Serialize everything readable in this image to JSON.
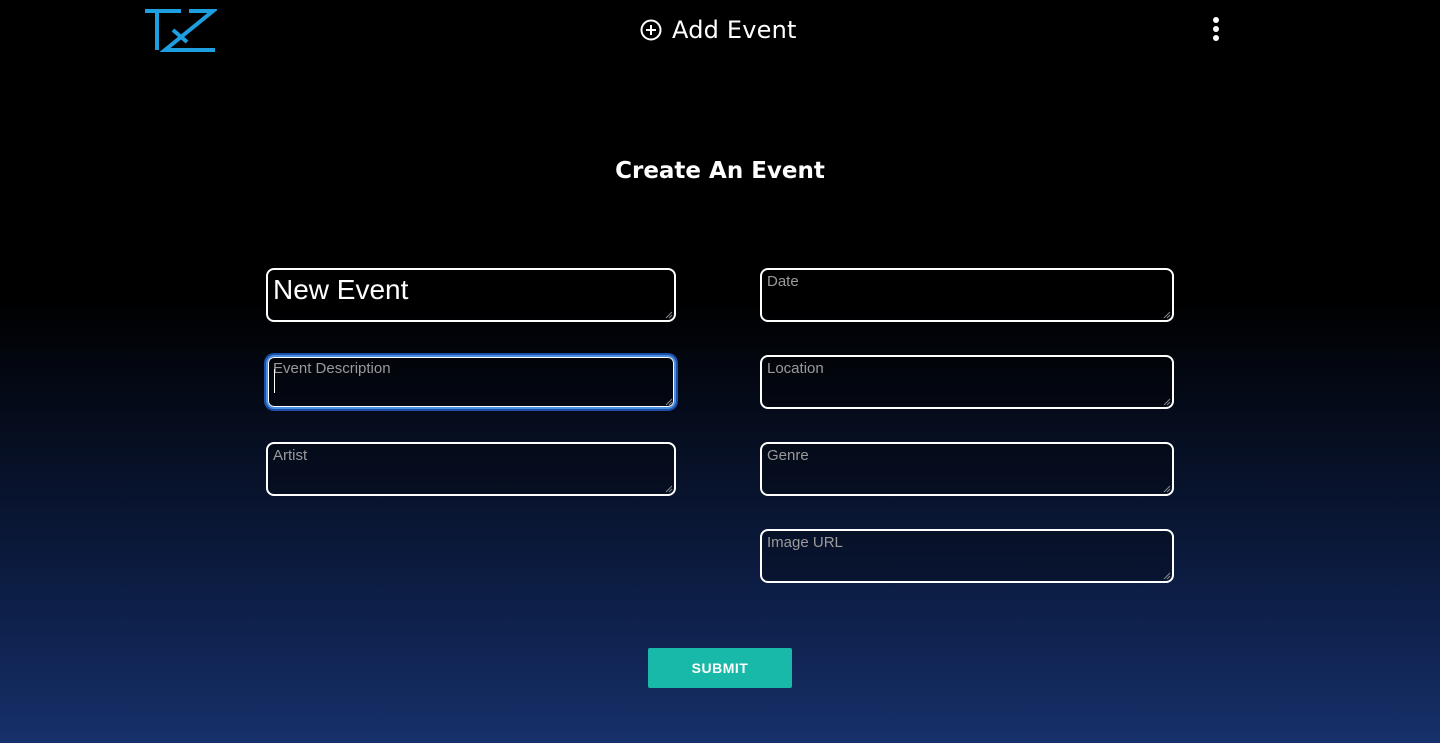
{
  "header": {
    "logo_icon": "tz-logo-icon",
    "add_event_label": "Add Event",
    "add_event_icon": "plus-circle-icon",
    "menu_icon": "kebab-menu-icon"
  },
  "page": {
    "title": "Create An Event"
  },
  "form": {
    "event_name": {
      "value": "New Event"
    },
    "event_description": {
      "placeholder": "Event Description",
      "value": ""
    },
    "artist": {
      "placeholder": "Artist",
      "value": ""
    },
    "date": {
      "placeholder": "Date",
      "value": ""
    },
    "location": {
      "placeholder": "Location",
      "value": ""
    },
    "genre": {
      "placeholder": "Genre",
      "value": ""
    },
    "image_url": {
      "placeholder": "Image URL",
      "value": ""
    },
    "submit_label": "SUBMIT"
  },
  "colors": {
    "logo": "#1d9fe0",
    "submit_bg": "#19b9a9",
    "focus_ring": "#4a90e2"
  }
}
